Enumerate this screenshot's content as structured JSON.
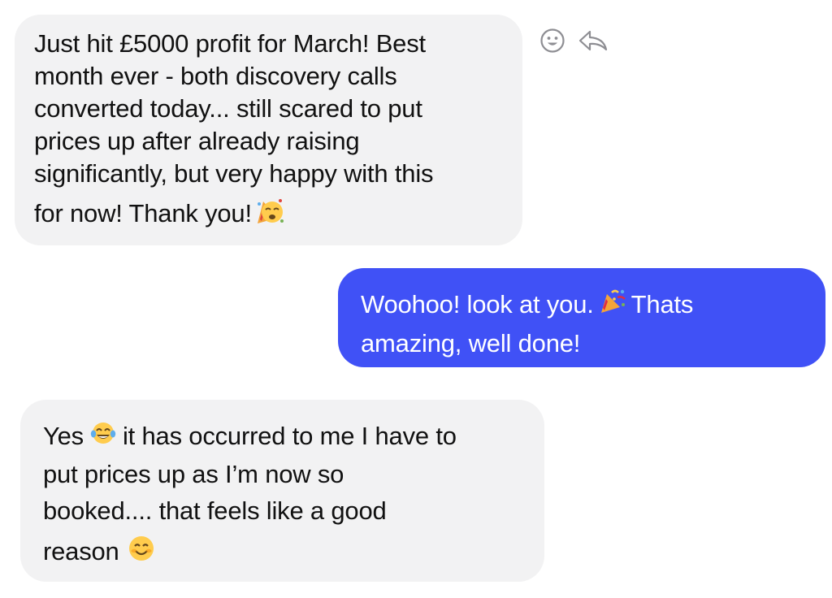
{
  "messages": [
    {
      "direction": "incoming",
      "lines": [
        "Just hit £5000 profit for March! Best",
        "month ever - both discovery calls",
        "converted today... still scared to put",
        "prices up after already raising",
        "significantly, but very happy with this",
        "for now! Thank you!"
      ],
      "emoji": "partying-face-emoji"
    },
    {
      "direction": "outgoing",
      "lines": [
        "Woohoo! look at you.",
        "Thats",
        "amazing, well done!"
      ],
      "emoji": "party-popper-emoji"
    },
    {
      "direction": "incoming",
      "lines": [
        "Yes",
        "it has occurred to me I have to",
        "put prices up as I’m now so",
        "booked.... that feels like a good",
        "reason"
      ],
      "emojis": [
        "tears-of-joy-emoji",
        "smiling-face-emoji"
      ]
    }
  ],
  "actions": {
    "react_icon": "smiley-icon",
    "reply_icon": "reply-arrow-icon"
  },
  "colors": {
    "incoming_bubble": "#f2f2f3",
    "outgoing_bubble": "#4051f6",
    "icon_gray": "#8e8e93"
  }
}
